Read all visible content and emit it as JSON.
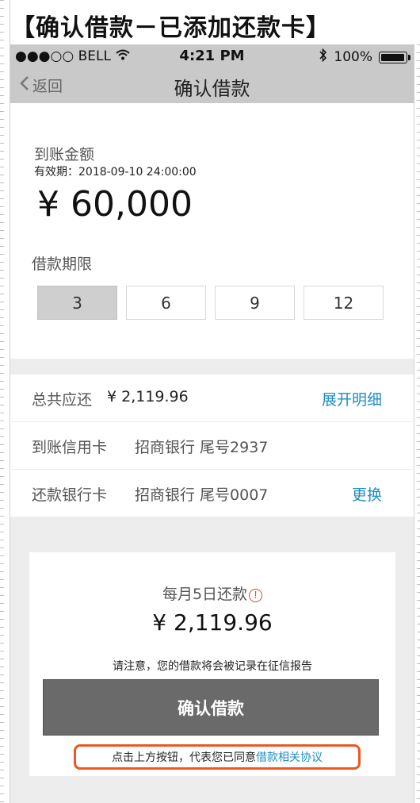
{
  "page_title": "【确认借款－已添加还款卡】",
  "status_bar": {
    "carrier": "●●●○○ BELL",
    "time": "4:21 PM",
    "battery": "100%"
  },
  "nav": {
    "back_label": "返回",
    "title": "确认借款"
  },
  "amount_section": {
    "label": "到账金额",
    "validity": "有效期：2018-09-10 24:00:00",
    "amount": "¥ 60,000"
  },
  "term_section": {
    "label": "借款期限",
    "options": [
      "3",
      "6",
      "9",
      "12"
    ],
    "selected": "3"
  },
  "detail_rows": [
    {
      "label": "总共应还",
      "value": "¥ 2,119.96",
      "action": "展开明细"
    },
    {
      "label": "到账信用卡",
      "value": "招商银行  尾号2937",
      "action": ""
    },
    {
      "label": "还款银行卡",
      "value": "招商银行  尾号0007",
      "action": "更换"
    }
  ],
  "repayment": {
    "schedule": "每月5日还款",
    "amount": "¥ 2,119.96",
    "notice": "请注意，您的借款将会被记录在征信报告",
    "confirm_button": "确认借款",
    "agreement_prefix": "点击上方按钮，代表您已同意",
    "agreement_link": "借款相关协议"
  },
  "colors": {
    "link": "#1b8ec6",
    "highlight_border": "#f0561f",
    "button": "#6a6a6a"
  }
}
